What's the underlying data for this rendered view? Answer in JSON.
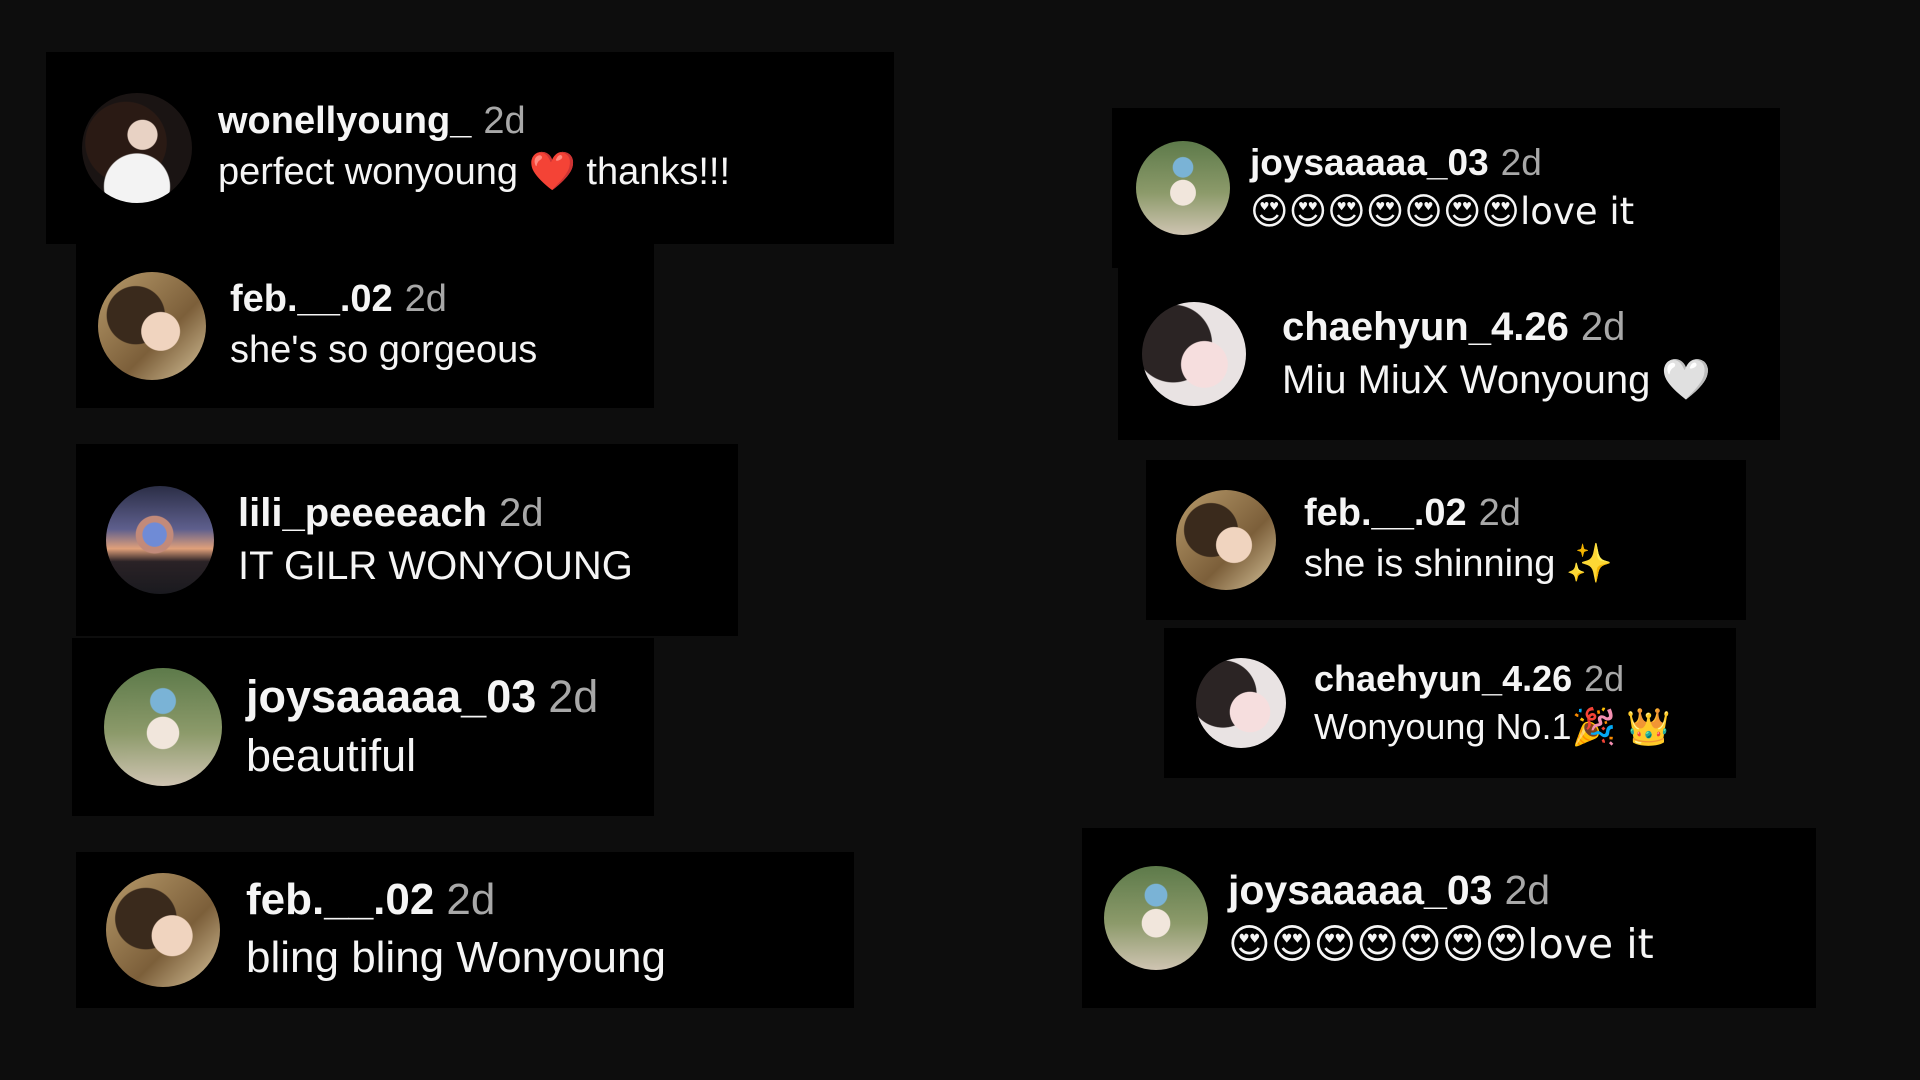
{
  "comments": [
    {
      "user": "wonellyoung_",
      "time": "2d",
      "text": "perfect wonyoung ❤️ thanks!!!",
      "avatar": "woman-portrait-avatar"
    },
    {
      "user": "feb.__.02",
      "time": "2d",
      "text": "she's so gorgeous",
      "avatar": "selfie-avatar"
    },
    {
      "user": "lili_peeeeach",
      "time": "2d",
      "text": "IT GILR WONYOUNG",
      "avatar": "sunset-avatar"
    },
    {
      "user": "joysaaaaa_03",
      "time": "2d",
      "text": "beautiful",
      "avatar": "park-avatar"
    },
    {
      "user": "feb.__.02",
      "time": "2d",
      "text": "bling bling Wonyoung",
      "avatar": "selfie-avatar"
    },
    {
      "user": "joysaaaaa_03",
      "time": "2d",
      "text": "😍😍😍😍😍😍😍love it",
      "avatar": "park-avatar"
    },
    {
      "user": "chaehyun_4.26",
      "time": "2d",
      "text": "Miu MiuX Wonyoung 🤍",
      "avatar": "pale-avatar"
    },
    {
      "user": "feb.__.02",
      "time": "2d",
      "text": "she is shinning ✨",
      "avatar": "selfie-avatar"
    },
    {
      "user": "chaehyun_4.26",
      "time": "2d",
      "text": "Wonyoung No.1🎉 👑",
      "avatar": "pale-avatar"
    },
    {
      "user": "joysaaaaa_03",
      "time": "2d",
      "text": "😍😍😍😍😍😍😍love it",
      "avatar": "park-avatar"
    }
  ]
}
